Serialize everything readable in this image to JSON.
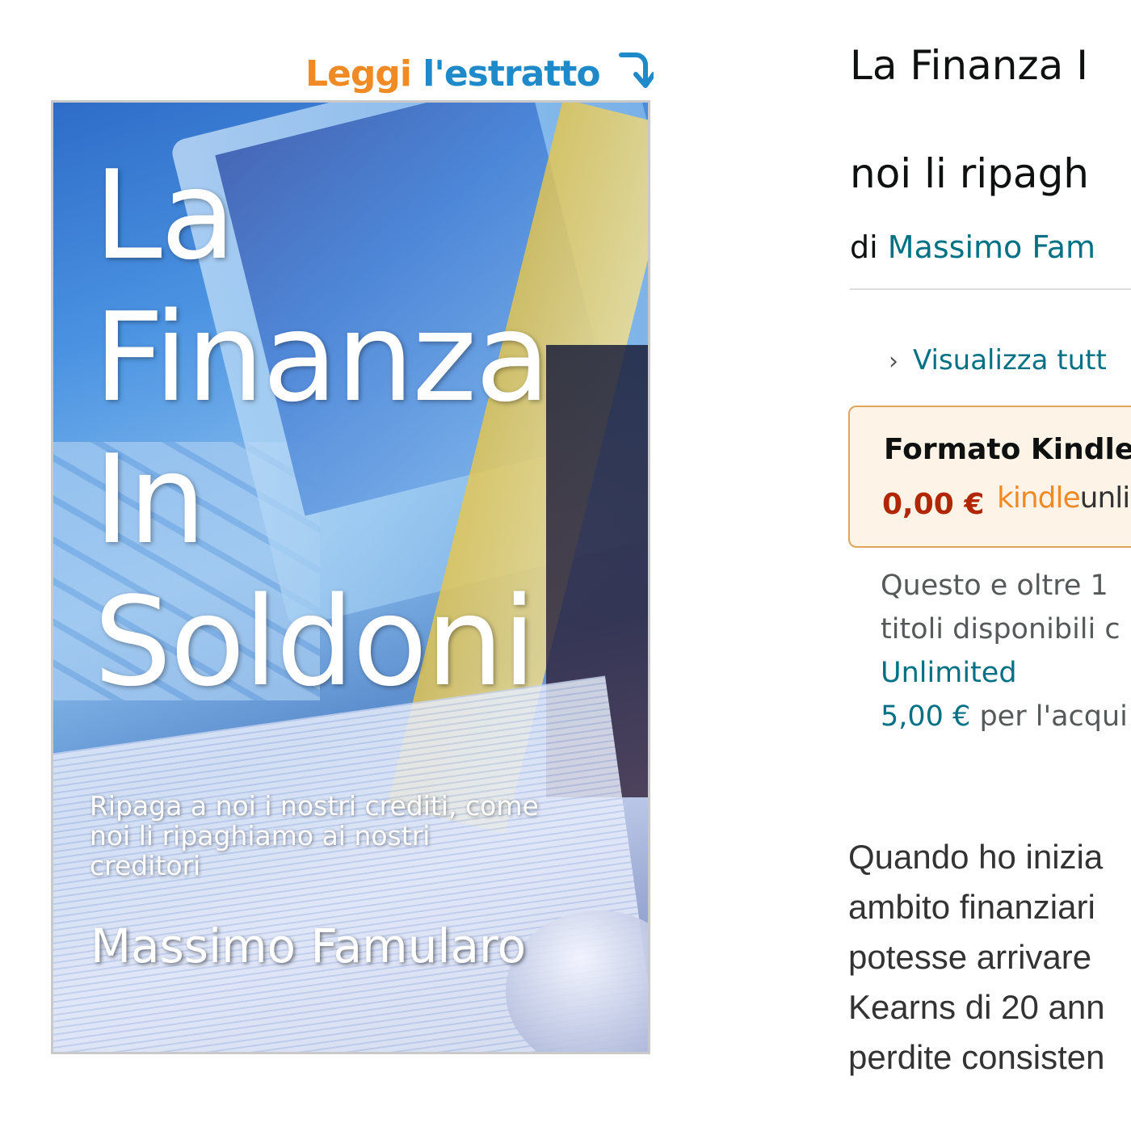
{
  "look_inside": {
    "word1": "Leggi",
    "word2": "l'estratto",
    "icon": "curved-down-arrow-icon"
  },
  "cover": {
    "title_lines": [
      "La",
      "Finanza",
      "In",
      "Soldoni"
    ],
    "subtitle_lines": [
      "Ripaga a noi i nostri crediti, come",
      "noi li ripaghiamo ai nostri",
      "creditori"
    ],
    "author": "Massimo Famularo"
  },
  "product": {
    "title_line1": "La Finanza I",
    "title_line2": "noi li ripagh",
    "by_prefix": "di",
    "author": "Massimo Fam",
    "see_all": "Visualizza tutt",
    "see_all_icon": "chevron-right-icon"
  },
  "format": {
    "name": "Formato Kindle",
    "price": "0,00 €",
    "logo_kindle": "kindle",
    "logo_unlimited": "unli"
  },
  "ku_note": {
    "line1": "Questo e oltre 1",
    "line2": "titoli disponibili c",
    "link": "Unlimited",
    "price": "5,00 €",
    "price_suffix": "per l'acqui"
  },
  "description": {
    "lines": [
      "Quando ho inizia",
      "ambito finanziari",
      "potesse arrivare",
      "Kearns di 20 ann",
      "perdite consisten"
    ]
  },
  "colors": {
    "link": "#007185",
    "price": "#b12704",
    "look_inside_orange": "#f08a24",
    "look_inside_blue": "#1f8ac9",
    "format_border": "#e0a55d",
    "format_bg": "#fdf3e7"
  }
}
